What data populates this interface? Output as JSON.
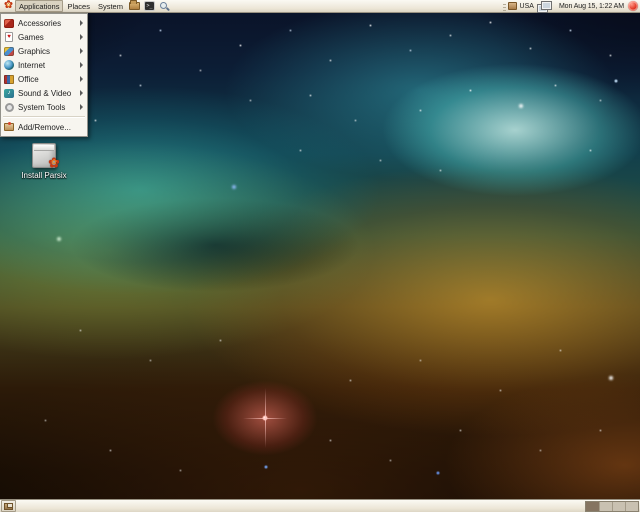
{
  "top_panel": {
    "logo_glyph": "✿",
    "menus": [
      {
        "label": "Applications",
        "state": "open"
      },
      {
        "label": "Places",
        "state": "closed"
      },
      {
        "label": "System",
        "state": "closed"
      }
    ],
    "launchers": [
      {
        "icon": "home-folder-icon"
      },
      {
        "icon": "terminal-icon",
        "glyph": ">_"
      },
      {
        "icon": "search-icon"
      }
    ],
    "tray": {
      "package_icon": "package-icon",
      "keyboard_layout": "USA",
      "network_icon": "network-monitors-icon"
    },
    "clock": "Mon Aug 15, 1:22 AM",
    "power_icon": "power-icon"
  },
  "applications_menu": {
    "items": [
      {
        "label": "Accessories",
        "icon": "accessories-icon",
        "has_submenu": true
      },
      {
        "label": "Games",
        "icon": "games-card-icon",
        "glyph": "♥",
        "has_submenu": true
      },
      {
        "label": "Graphics",
        "icon": "graphics-palette-icon",
        "has_submenu": true
      },
      {
        "label": "Internet",
        "icon": "internet-globe-icon",
        "has_submenu": true
      },
      {
        "label": "Office",
        "icon": "office-books-icon",
        "has_submenu": true
      },
      {
        "label": "Sound & Video",
        "icon": "sound-video-icon",
        "glyph": "♪",
        "has_submenu": true
      },
      {
        "label": "System Tools",
        "icon": "system-tools-icon",
        "has_submenu": true
      },
      {
        "label": "Add/Remove...",
        "icon": "add-remove-package-icon",
        "has_submenu": false
      }
    ]
  },
  "desktop": {
    "icons": [
      {
        "label": "Install Parsix",
        "icon": "installer-package-icon",
        "logo_glyph": "✿"
      }
    ]
  },
  "bottom_panel": {
    "show_desktop_icon": "show-desktop-icon",
    "workspace_switcher": {
      "count": 4,
      "active_index": 0
    }
  },
  "colors": {
    "panel_bg_top": "#fbf9f3",
    "panel_bg_bottom": "#ddd6c5",
    "menu_bg": "#f7f5ef",
    "accent_red": "#c63812",
    "workspace_active": "#857461",
    "workspace_inactive": "#c9c1b1"
  }
}
